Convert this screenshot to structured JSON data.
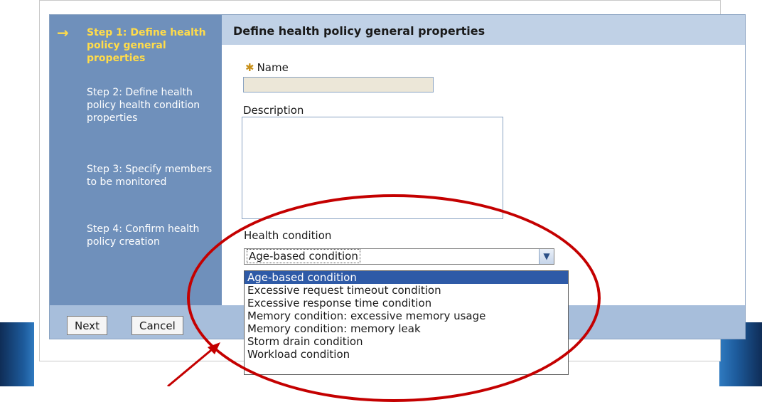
{
  "wizard": {
    "steps": [
      {
        "label": "Step 1: Define health policy general properties",
        "active": true
      },
      {
        "label": "Step 2: Define health policy health condition properties",
        "active": false
      },
      {
        "label": "Step 3: Specify members to be monitored",
        "active": false
      },
      {
        "label": "Step 4: Confirm health policy creation",
        "active": false
      }
    ],
    "title": "Define health policy general properties"
  },
  "form": {
    "name_label": "Name",
    "name_value": "",
    "description_label": "Description",
    "description_value": "",
    "health_condition_label": "Health condition",
    "health_condition_selected": "Age-based condition",
    "health_condition_options": [
      "Age-based condition",
      "Excessive request timeout condition",
      "Excessive response time condition",
      "Memory condition: excessive memory usage",
      "Memory condition: memory leak",
      "Storm drain condition",
      "Workload condition"
    ]
  },
  "buttons": {
    "next": "Next",
    "cancel": "Cancel"
  },
  "icons": {
    "current_step": "arrow-right-icon",
    "required": "asterisk-icon",
    "dropdown": "chevron-down-icon"
  },
  "colors": {
    "steps_panel": "#6f90bb",
    "active_step": "#ffdc4a",
    "header": "#c0d1e6",
    "selected_option": "#2e5aa7",
    "annotation": "#c40000"
  }
}
